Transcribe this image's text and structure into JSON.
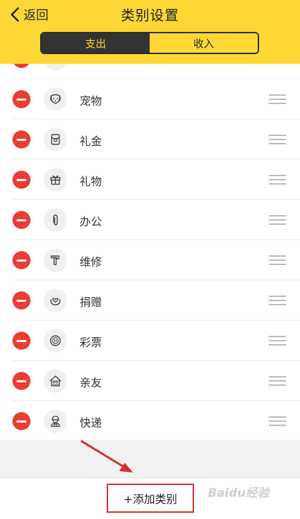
{
  "header": {
    "back_label": "返回",
    "title": "类别设置",
    "tabs": [
      {
        "label": "支出",
        "active": true
      },
      {
        "label": "收入",
        "active": false
      }
    ]
  },
  "categories": [
    {
      "label": "",
      "icon": "partial-icon"
    },
    {
      "label": "宠物",
      "icon": "dog-icon"
    },
    {
      "label": "礼金",
      "icon": "red-envelope-icon"
    },
    {
      "label": "礼物",
      "icon": "gift-icon"
    },
    {
      "label": "办公",
      "icon": "paperclip-icon"
    },
    {
      "label": "维修",
      "icon": "hammer-icon"
    },
    {
      "label": "捐赠",
      "icon": "heart-hand-icon"
    },
    {
      "label": "彩票",
      "icon": "lottery-ball-icon"
    },
    {
      "label": "亲友",
      "icon": "house-people-icon"
    },
    {
      "label": "快递",
      "icon": "courier-icon"
    }
  ],
  "bottom": {
    "add_label": "+添加类别"
  },
  "watermark": {
    "text": "Baidu经验"
  },
  "colors": {
    "header_bg": "#fdd835",
    "tab_active_bg": "#333333",
    "delete_red": "#ea3d33",
    "annotation_red": "#d32f2f"
  }
}
